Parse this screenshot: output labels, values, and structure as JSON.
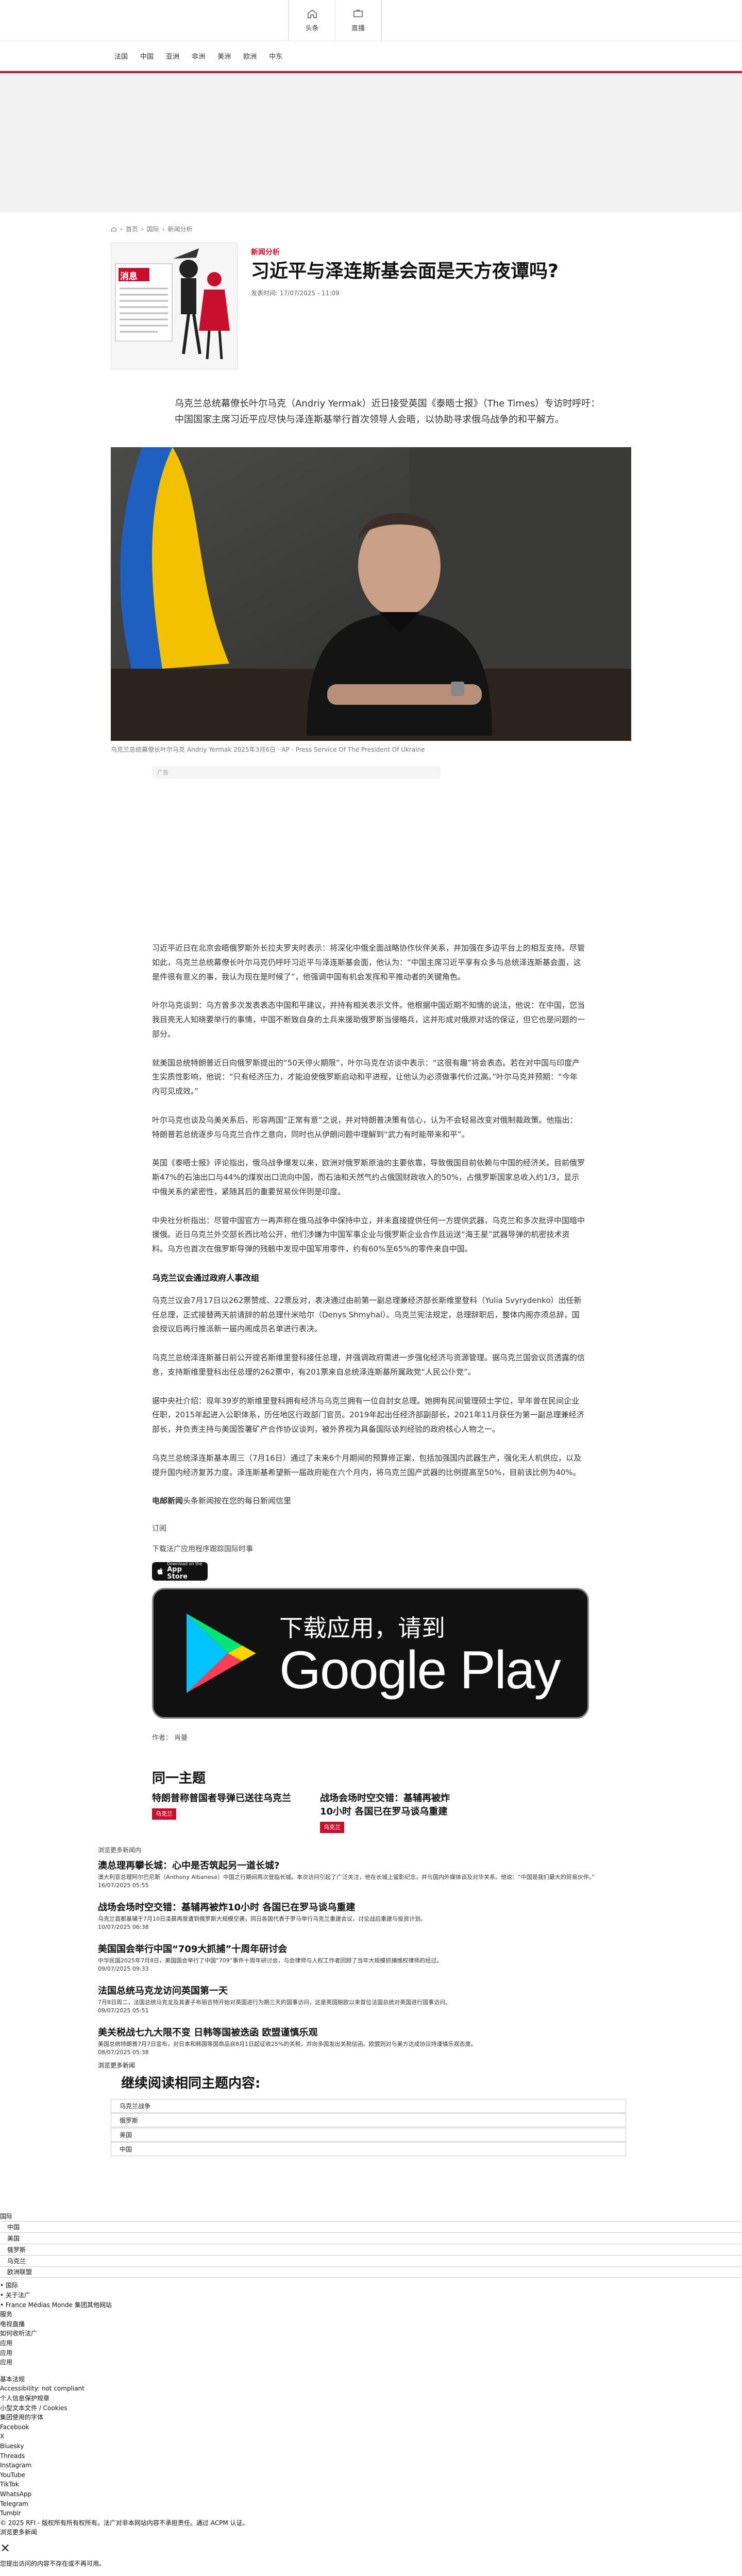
{
  "header": {
    "home_label": "头条",
    "live_label": "直播",
    "nav": [
      "法国",
      "中国",
      "亚洲",
      "非洲",
      "美洲",
      "欧洲",
      "中东"
    ]
  },
  "breadcrumb": [
    "首页",
    "国际",
    "新闻分析"
  ],
  "article": {
    "kicker": "新闻分析",
    "title": "习近平与泽连斯基会面是天方夜谭吗?",
    "meta": "发表时间: 17/07/2025 - 11:09",
    "thumb_label": "消息",
    "lede": "乌克兰总统幕僚长叶尔马克（Andriy Yermak）近日接受英国《泰晤士报》（The Times）专访时呼吁：中国国家主席习近平应尽快与泽连斯基举行首次领导人会晤，以协助寻求俄乌战争的和平解方。",
    "caption": "乌克兰总统幕僚长叶尔马克 Andriy Yermak 2025年3月6日 · AP - Press Service Of The President Of Ukraine",
    "ad_label": "广告",
    "body": [
      "习近平近日在北京会晤俄罗斯外长拉夫罗夫时表示：将深化中俄全面战略协作伙伴关系，并加强在多边平台上的相互支持。尽管如此，乌克兰总统幕僚长叶尔马克仍呼吁习近平与泽连斯基会面，他认为：“中国主席习近平享有众多与总统泽连斯基会面，这是件很有意义的事，我认为现在是时候了”，他强调中国有机会发挥和平推动者的关键角色。",
      "叶尔马克谈到：乌方曾多次发表表态中国和平建议，并持有相关表示文件。他根据中国近期不知情的说法，他说：在中国，您当我目亮无人知晓要举行的事情，中国不断致自身的土兵来援助俄罗斯当侵略兵，这并形成对俄原对话的保证，但它也是问题的一部分。",
      "就美国总统特朗普近日向俄罗斯提出的“50天停火期限”，叶尔马克在访谈中表示：“这很有趣”将会表态。若在对中国与印度产生实质性影响，他说：“只有经济压力，才能迫使俄罗斯启动和平进程，让他认为必须做事代价过高。”叶尔马克并预期：“今年内可见成效。”",
      "叶尔马克也谈及乌美关系后，形容两国“正常有意”之说，并对特朗普决策有信心，认为不会轻易改变对俄制裁政策。他指出：特朗普若总统逐步与乌克兰合作之意向，同时也从伊朗问题中理解到“武力有时能带来和平”。",
      "英国《泰晤士报》评论指出，俄乌战争爆发以来，欧洲对俄罗斯原油的主要依靠，导致俄国目前依赖与中国的经济关。目前俄罗斯47%的石油出口与44%的煤炭出口流向中国，而石油和天然气约占俄国财政收入的50%，占俄罗斯国家总收入约1/3，显示中俄关系的紧密性，紧随其后的重要贸易伙伴则是印度。",
      "中央社分析指出：尽管中国官方一再声称在俄乌战争中保持中立，并未直接提供任何一方提供武器，乌克兰和多次批评中国暗中援俄。近日乌克兰外交部长西比哈公开，他们涉嫌为中国军事企业与俄罗斯企业合作且运送“海王星”武器导弹的机密技术资料。乌方也首次在俄罗斯导弹的残骸中发现中国军用零件，约有60%至65%的零件来自中国。"
    ],
    "section_heading": "乌克兰议会通过政府人事改组",
    "body2": [
      "乌克兰议会7月17日以262票赞成、22票反对，表决通过由前第一副总理兼经济部长斯维里登科（Yulia Svyrydenko）出任新任总理，正式接替两天前请辞的前总理什米哈尔（Denys Shmyhal）。乌克兰宪法规定，总理辞职后，整体内阁亦须总辞，国会授议后再行推派新一届内阁成员名单进行表决。",
      "乌克兰总统泽连斯基日前公开提名斯维里登科接任总理，并强调政府需进一步强化经济与资源管理。据乌克兰国会议员透露的信息，支持斯维里登科出任总理的262票中，有201票来自总统泽连斯基所属政党“人民公仆党”。",
      "据中央社介绍：现年39岁的斯维里登科拥有经济与乌克兰拥有一位自封女总理。她拥有民间管理硕士学位，早年曾在民间企业任职，2015年起进入公职体系，历任地区行政部门官员。2019年起出任经济部副部长，2021年11月获任为第一副总理兼经济部长，并负责主持与美国签署矿产合作协议谈判，被外界视为具备国际谈判经验的政府核心人物之一。",
      "乌克兰总统泽连斯基本周三（7月16日）通过了未来6个月期间的预算修正案，包括加强国内武器生产，强化无人机供应，以及提升国内经济复苏力度。泽连斯基希望新一届政府能在六个月内，将乌克兰国产武器的比例提高至50%，目前该比例为40%。"
    ],
    "signoff_bold": "电邮新闻",
    "signoff_rest": "头条新闻按在您的每日新闻信里",
    "subscribe": "订阅",
    "app_download": "下载法广应用程序跟踪国际时事",
    "appstore_small": "Download on the",
    "appstore_large": "App Store",
    "gplay_small": "下载应用，请到",
    "gplay_large": "Google Play",
    "author": "作者： 肖曼"
  },
  "topic": {
    "title": "同一主题",
    "cards": [
      {
        "title": "特朗普称普国者导弹已送往乌克兰",
        "tag": "乌克兰"
      },
      {
        "title": "战场会场时空交错：基辅再被炸10小时 各国已在罗马谈乌重建",
        "tag": "乌克兰"
      }
    ]
  },
  "latest": {
    "label": "浏览更多新闻内",
    "items": [
      {
        "title": "澳总理再攀长城：心中是否筑起另一道长城?",
        "text": "澳大利亚总理阿尔巴尼斯（Anthony Albanese）中国之行期间再次登临长城。本次访问引起了广泛关注，他在长城上留影纪念，并与国内外媒体谈及对华关系。他说：“中国是我们最大的贸易伙伴。”",
        "date": "16/07/2025 05:55"
      },
      {
        "title": "战场会场时空交错：基辅再被炸10小时 各国已在罗马谈乌重建",
        "text": "乌克兰首都基辅于7月10日凌晨再度遭到俄罗斯大规模空袭，同日各国代表于罗马举行乌克兰重建会议，讨论战后重建与投资计划。",
        "date": "10/07/2025 06:38"
      },
      {
        "title": "美国国会举行中国“709大抓捕”十周年研讨会",
        "text": "中华民国2025年7月8日，美国国会举行了中国“709”事件十周年研讨会，与会律师与人权工作者回顾了当年大规模抓捕维权律师的经过。",
        "date": "09/07/2025 09:33"
      },
      {
        "title": "法国总统马克龙访问英国第一天",
        "text": "7月8日周二，法国总统马克龙及其妻子布丽吉特开始对英国进行为期三天的国事访问，这是英国脱欧以来首位法国总统对英国进行国事访问。",
        "date": "09/07/2025 05:51"
      },
      {
        "title": "美关税战七九大限不变 日韩等国被迭函 欧盟谨慎乐观",
        "text": "美国总统特朗普7月7日宣布，对日本和韩国等国商品自8月1日起征收25%的关税，并向多国发出关税信函。欧盟则对与美方达成协议持谨慎乐观态度。",
        "date": "08/07/2025 05:38"
      }
    ],
    "more_label": "浏览更多新闻"
  },
  "more_reading": {
    "title": "继续阅读相同主题内容:",
    "items": [
      "乌克兰战争",
      "俄罗斯",
      "美国",
      "中国"
    ]
  },
  "footer": {
    "section_label": "国际",
    "rows": [
      "中国",
      "美国",
      "俄罗斯",
      "乌克兰",
      "欧洲联盟"
    ],
    "lines": [
      "• 国际",
      "• 关于法广",
      "• France Médias Monde 集团其他网站",
      "服务",
      "电视直播",
      "如何收听法广",
      "应用",
      "应用",
      "应用",
      "",
      "基本法规",
      "Accessibility: not compliant",
      "个人信息保护规章",
      "小型文本文件 / Cookies",
      "集团使用的字体",
      "Facebook",
      "X",
      "Bluesky",
      "Threads",
      "Instagram",
      "YouTube",
      "TikTok",
      "WhatsApp",
      "Telegram",
      "Tumblr"
    ],
    "copyright": "© 2025 RFI - 版权所有所有权所有。法广对非本网站内容不承担责任。通过 ACPM 认证。",
    "more_news": "浏览更多新闻",
    "close": "×",
    "notice": "您提出访问的内容不存在或不再可用。"
  },
  "colors": {
    "accent": "#c8102e"
  }
}
